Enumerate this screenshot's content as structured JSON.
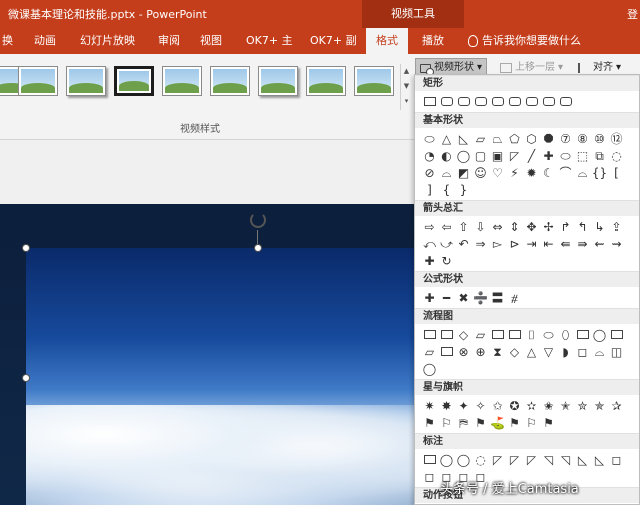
{
  "titlebar": {
    "title": "微课基本理论和技能.pptx - PowerPoint",
    "context_tab": "视频工具",
    "right_edge": "登"
  },
  "tabs": [
    {
      "label": "换",
      "active": false
    },
    {
      "label": "动画",
      "active": false
    },
    {
      "label": "幻灯片放映",
      "active": false
    },
    {
      "label": "审阅",
      "active": false
    },
    {
      "label": "视图",
      "active": false
    },
    {
      "label": "OK7+ 主",
      "active": false
    },
    {
      "label": "OK7+ 副",
      "active": false
    },
    {
      "label": "格式",
      "active": true
    },
    {
      "label": "播放",
      "active": false
    }
  ],
  "tell_me": "告诉我你想要做什么",
  "ribbon": {
    "video_shape_button": "视频形状",
    "bring_forward_button": "上移一层",
    "align_button": "对齐",
    "group_label": "视频样式"
  },
  "shapes_panel": {
    "categories": [
      {
        "label": "矩形",
        "shapes": [
          "▭",
          "▭",
          "▭",
          "▭",
          "▭",
          "▭",
          "▭",
          "▭",
          "▭"
        ]
      },
      {
        "label": "基本形状",
        "shapes": [
          "⬭",
          "△",
          "◺",
          "▱",
          "⏢",
          "⬠",
          "⬡",
          "⯃",
          "⑦",
          "⑧",
          "⑩",
          "⑫",
          "◔",
          "◐",
          "◯",
          "▢",
          "▣",
          "◸",
          "╱",
          "✚",
          "⬭",
          "⬚",
          "⧉",
          "◌",
          "⊘",
          "⌓",
          "◩",
          "☺",
          "♡",
          "⚡",
          "✹",
          "☾",
          "⌒",
          "⌓",
          "{}",
          "[",
          "]",
          "{",
          "}"
        ]
      },
      {
        "label": "箭头总汇",
        "shapes": [
          "⇨",
          "⇦",
          "⇧",
          "⇩",
          "⇔",
          "⇕",
          "✥",
          "✢",
          "↱",
          "↰",
          "↳",
          "⇪",
          "⤺",
          "⤻",
          "↶",
          "⇒",
          "▻",
          "⊳",
          "⇥",
          "⇤",
          "⇚",
          "⇛",
          "⇜",
          "⇝",
          "✚",
          "↻"
        ]
      },
      {
        "label": "公式形状",
        "shapes": [
          "✚",
          "━",
          "✖",
          "➗",
          "〓",
          "⧣"
        ]
      },
      {
        "label": "流程图",
        "shapes": [
          "▭",
          "▭",
          "◇",
          "▱",
          "▭",
          "▭",
          "⌷",
          "⬭",
          "⬯",
          "▭",
          "◯",
          "▭",
          "▱",
          "▭",
          "⊗",
          "⊕",
          "⧗",
          "◇",
          "△",
          "▽",
          "◗",
          "◻",
          "⌓",
          "◫",
          "◯"
        ]
      },
      {
        "label": "星与旗帜",
        "shapes": [
          "✷",
          "✸",
          "✦",
          "✧",
          "✩",
          "✪",
          "✫",
          "✬",
          "✭",
          "✮",
          "✯",
          "✰",
          "⚑",
          "⚐",
          "⛿",
          "⚑",
          "⛳",
          "⚑",
          "⚐",
          "⚑"
        ]
      },
      {
        "label": "标注",
        "shapes": [
          "▭",
          "◯",
          "◯",
          "◌",
          "◸",
          "◸",
          "◸",
          "◹",
          "◹",
          "◺",
          "◺",
          "◻",
          "◻",
          "◻",
          "◻",
          "◻"
        ]
      },
      {
        "label": "动作按钮",
        "shapes": [
          "◁",
          "▷",
          "▷",
          "▢",
          "▢",
          "▢",
          "▢",
          "▢"
        ]
      }
    ]
  },
  "watermark": "头条号 / 爱上Camtasia"
}
